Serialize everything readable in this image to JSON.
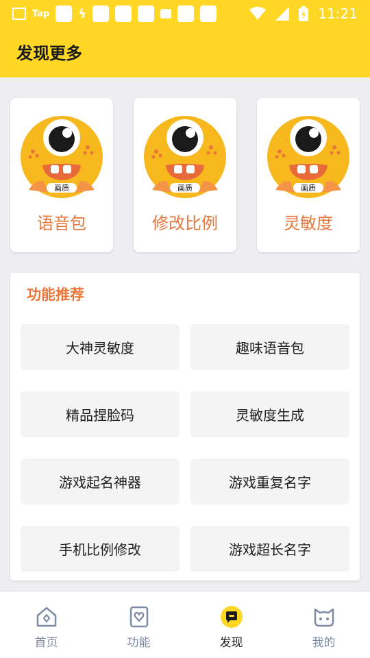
{
  "status_bar": {
    "carrier_label": "Tap",
    "time": "11:21",
    "icons": [
      "image-icon",
      "tap-icon",
      "notification-icon",
      "bolt-icon",
      "notification-icon",
      "notification-icon",
      "notification-icon",
      "notification-icon",
      "notification-icon",
      "notification-icon",
      "wifi-icon",
      "signal-icon",
      "battery-icon"
    ]
  },
  "header": {
    "title": "发现更多"
  },
  "cards": [
    {
      "label": "语音包",
      "icon": "mascot-icon"
    },
    {
      "label": "修改比例",
      "icon": "mascot-icon"
    },
    {
      "label": "灵敏度",
      "icon": "mascot-icon"
    }
  ],
  "mascot": {
    "badge_text": "画质"
  },
  "features": {
    "title": "功能推荐",
    "items": [
      {
        "label": "大神灵敏度"
      },
      {
        "label": "趣味语音包"
      },
      {
        "label": "精品捏脸码"
      },
      {
        "label": "灵敏度生成"
      },
      {
        "label": "游戏起名神器"
      },
      {
        "label": "游戏重复名字"
      },
      {
        "label": "手机比例修改"
      },
      {
        "label": "游戏超长名字"
      }
    ]
  },
  "bottom_nav": {
    "items": [
      {
        "label": "首页",
        "icon": "home-icon"
      },
      {
        "label": "功能",
        "icon": "heart-icon"
      },
      {
        "label": "发现",
        "icon": "discover-icon"
      },
      {
        "label": "我的",
        "icon": "cat-icon"
      }
    ],
    "active_index": 2
  },
  "colors": {
    "brand_yellow": "#ffd724",
    "accent_orange": "#e8763a",
    "nav_inactive": "#7d8aa4"
  }
}
